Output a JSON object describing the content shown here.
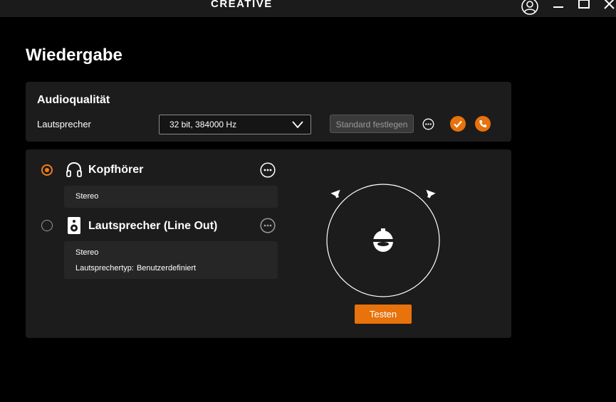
{
  "titlebar": {
    "brand": "CREATIVE",
    "icons": [
      "user-icon",
      "minimize-icon",
      "maximize-icon",
      "close-icon"
    ]
  },
  "page": {
    "title": "Wiedergabe"
  },
  "audio_quality": {
    "title": "Audioqualität",
    "device_label": "Lautsprecher",
    "format_value": "32 bit, 384000 Hz",
    "set_default_label": "Standard festlegen"
  },
  "devices": [
    {
      "name": "Kopfhörer",
      "selected": true,
      "icon": "headphones-icon",
      "info": [
        "Stereo"
      ]
    },
    {
      "name": "Lautsprecher (Line Out)",
      "selected": false,
      "icon": "speaker-icon",
      "info": [
        "Stereo"
      ],
      "type_label": "Lautsprechertyp:",
      "type_value": "Benutzerdefiniert"
    }
  ],
  "test": {
    "label": "Testen"
  },
  "colors": {
    "accent": "#e8720c",
    "panel": "#1c1c1c",
    "background": "#000000",
    "info_box": "#262626"
  }
}
